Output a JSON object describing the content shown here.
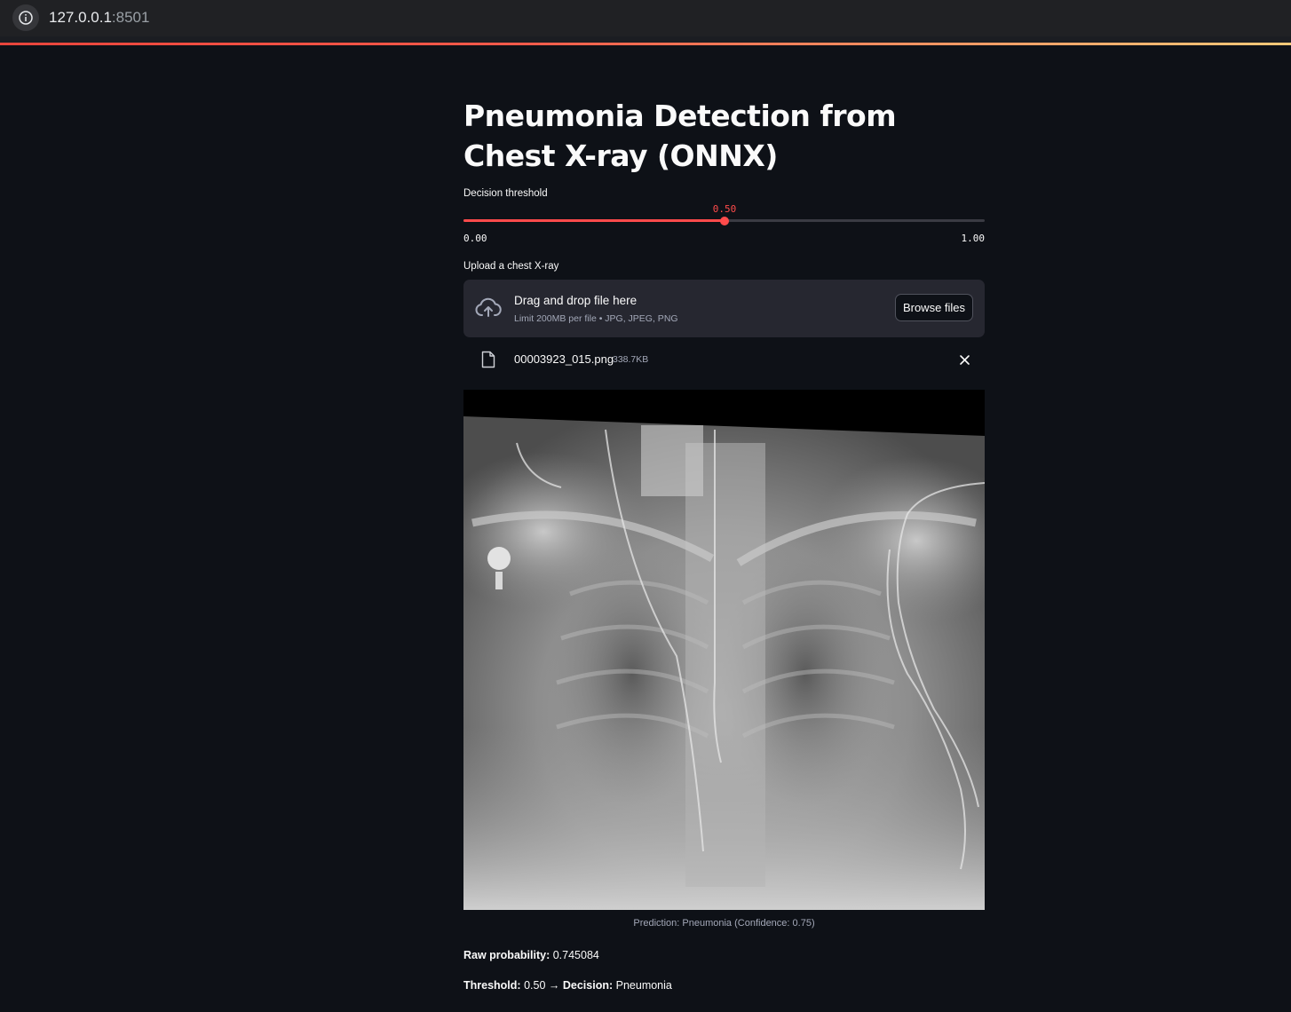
{
  "browser": {
    "url_host": "127.0.0.1",
    "url_port": ":8501",
    "info_icon": "info-icon"
  },
  "app": {
    "title": "Pneumonia Detection from Chest X-ray (ONNX)"
  },
  "threshold_slider": {
    "label": "Decision threshold",
    "value": 0.5,
    "value_text": "0.50",
    "min_text": "0.00",
    "max_text": "1.00",
    "min": 0,
    "max": 1,
    "accent_color": "#ff4b4b"
  },
  "uploader": {
    "label": "Upload a chest X-ray",
    "drop_title": "Drag and drop file here",
    "drop_subtitle": "Limit 200MB per file • JPG, JPEG, PNG",
    "browse_label": "Browse files",
    "icon": "cloud-upload-icon"
  },
  "uploaded_file": {
    "name": "00003923_015.png",
    "size": "338.7KB",
    "icon": "file-icon",
    "remove_icon": "close-icon"
  },
  "image": {
    "caption": "Prediction: Pneumonia (Confidence: 0.75)"
  },
  "results": {
    "raw_label": "Raw probability:",
    "raw_value": "0.745084",
    "threshold_label": "Threshold:",
    "threshold_value": "0.50 →",
    "decision_label": "Decision:",
    "decision_value": "Pneumonia"
  }
}
